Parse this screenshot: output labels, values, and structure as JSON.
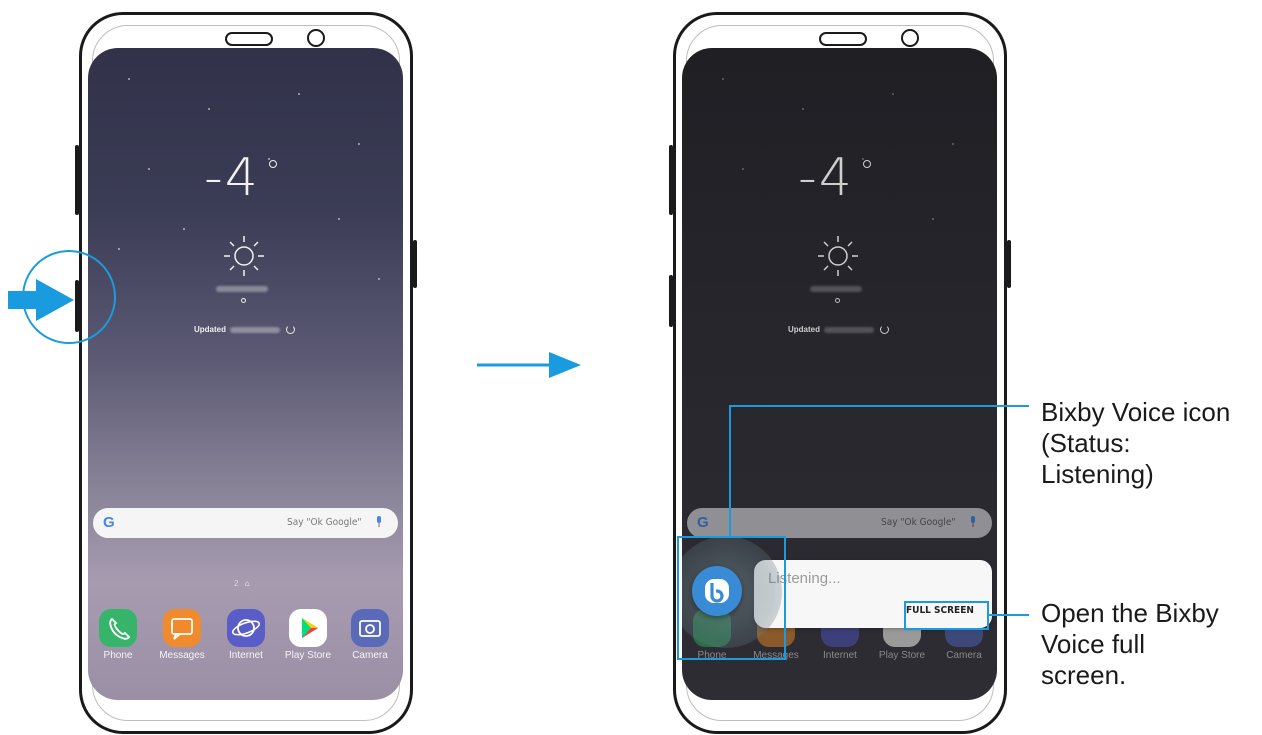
{
  "colors": {
    "accent": "#1a9be0",
    "phone_app_green": "#36b56a",
    "messages_orange": "#f08a2c",
    "internet_purple": "#5a5dc8",
    "camera_indigo": "#5a6ab8",
    "bixby_blue": "#3a8bd6"
  },
  "left_phone": {
    "temperature": "-4",
    "updated_label": "Updated",
    "search_hint": "Say \"Ok Google\"",
    "google_letter": "G",
    "page_indicator": "2",
    "apps": [
      {
        "label": "Phone",
        "icon": "phone-icon"
      },
      {
        "label": "Messages",
        "icon": "messages-icon"
      },
      {
        "label": "Internet",
        "icon": "internet-icon"
      },
      {
        "label": "Play Store",
        "icon": "play-store-icon"
      },
      {
        "label": "Camera",
        "icon": "camera-icon"
      }
    ]
  },
  "right_phone": {
    "temperature": "-4",
    "updated_label": "Updated",
    "search_hint": "Say \"Ok Google\"",
    "google_letter": "G",
    "listening_text": "Listening...",
    "full_screen_label": "FULL SCREEN",
    "apps": [
      {
        "label": "Phone",
        "icon": "phone-icon"
      },
      {
        "label": "Messages",
        "icon": "messages-icon"
      },
      {
        "label": "Internet",
        "icon": "internet-icon"
      },
      {
        "label": "Play Store",
        "icon": "play-store-icon"
      },
      {
        "label": "Camera",
        "icon": "camera-icon"
      }
    ]
  },
  "callouts": {
    "bixby_icon": "Bixby Voice icon (Status: Listening)",
    "bixby_icon_lines": [
      "Bixby Voice icon",
      "(Status:",
      "Listening)"
    ],
    "full_screen": "Open the Bixby Voice full screen.",
    "full_screen_lines": [
      "Open the Bixby",
      "Voice full",
      "screen."
    ]
  }
}
